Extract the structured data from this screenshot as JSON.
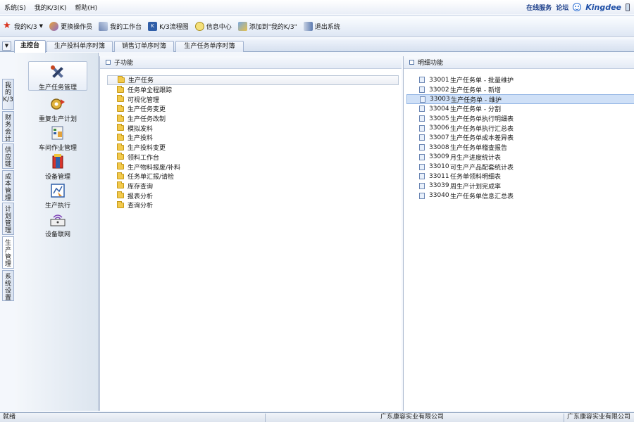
{
  "menubar": {
    "items": [
      "系统(S)",
      "我的K/3(K)",
      "帮助(H)"
    ],
    "online_service": "在线服务",
    "forum": "论坛",
    "brand": "Kingdee"
  },
  "toolbar": {
    "items": [
      "我的K/3",
      "更换操作员",
      "我的工作台",
      "K/3流程图",
      "信息中心",
      "添加到\"我的K/3\"",
      "退出系统"
    ]
  },
  "tabs": [
    "主控台",
    "生产投料单序时簿",
    "销售订单序时簿",
    "生产任务单序时簿"
  ],
  "vertical_tabs": [
    "我的K/3",
    "财务会计",
    "供应链",
    "成本管理",
    "计划管理",
    "生产管理",
    "系统设置"
  ],
  "icon_panel": {
    "items": [
      "生产任务管理",
      "重复生产计划",
      "车间作业管理",
      "设备管理",
      "生产执行",
      "设备联网"
    ]
  },
  "sub_panel": {
    "title": "子功能",
    "items": [
      "生产任务",
      "任务单全程跟踪",
      "可视化管理",
      "生产任务变更",
      "生产任务改制",
      "模拟发料",
      "生产投料",
      "生产投料变更",
      "领料工作台",
      "生产物料报废/补料",
      "任务单汇报/请检",
      "库存查询",
      "报表分析",
      "查询分析"
    ]
  },
  "detail_panel": {
    "title": "明细功能",
    "items": [
      {
        "code": "33001",
        "name": "生产任务单 - 批量维护"
      },
      {
        "code": "33002",
        "name": "生产任务单 - 新增"
      },
      {
        "code": "33003",
        "name": "生产任务单 - 维护"
      },
      {
        "code": "33004",
        "name": "生产任务单 - 分割"
      },
      {
        "code": "33005",
        "name": "生产任务单执行明细表"
      },
      {
        "code": "33006",
        "name": "生产任务单执行汇总表"
      },
      {
        "code": "33007",
        "name": "生产任务单成本差异表"
      },
      {
        "code": "33008",
        "name": "生产任务单稽查报告"
      },
      {
        "code": "33009",
        "name": "月生产进度统计表"
      },
      {
        "code": "33010",
        "name": "可生产产品配套统计表"
      },
      {
        "code": "33011",
        "name": "任务单领料明细表"
      },
      {
        "code": "33039",
        "name": "周生产计划完成率"
      },
      {
        "code": "33040",
        "name": "生产任务单信息汇总表"
      }
    ]
  },
  "statusbar": {
    "state": "就绪",
    "company": "广东康容实业有限公司",
    "company2": "广东康容实业有限公司"
  }
}
